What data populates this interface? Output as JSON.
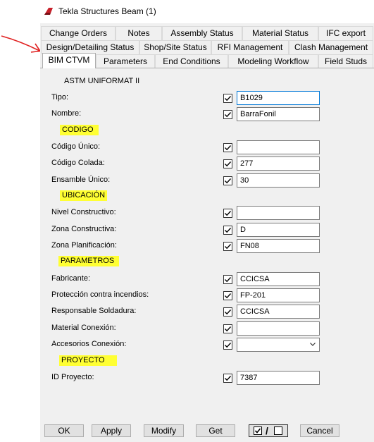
{
  "window": {
    "title": "Tekla Structures  Beam (1)"
  },
  "tabs": {
    "row1": [
      "Change Orders",
      "Notes",
      "Assembly Status",
      "Material Status",
      "IFC export"
    ],
    "row2": [
      "Design/Detailing Status",
      "Shop/Site Status",
      "RFI Management",
      "Clash Management"
    ],
    "row3": [
      "BIM CTVM",
      "Parameters",
      "End Conditions",
      "Modeling Workflow",
      "Field Studs"
    ]
  },
  "panel": {
    "caption": "ASTM UNIFORMAT II",
    "sections": [
      "CODIGO",
      "UBICACIÓN",
      "PARAMETROS",
      "PROYECTO"
    ],
    "fields": [
      {
        "label": "Tipo:",
        "value": "B1029",
        "checked": true
      },
      {
        "label": "Nombre:",
        "value": "BarraFonil",
        "checked": true
      },
      {
        "label": "Código Único:",
        "value": "",
        "checked": true
      },
      {
        "label": "Código Colada:",
        "value": "277",
        "checked": true
      },
      {
        "label": "Ensamble Único:",
        "value": "30",
        "checked": true
      },
      {
        "label": "Nivel Constructivo:",
        "value": "",
        "checked": true
      },
      {
        "label": "Zona Constructiva:",
        "value": "D",
        "checked": true
      },
      {
        "label": "Zona Planificación:",
        "value": "FN08",
        "checked": true
      },
      {
        "label": "Fabricante:",
        "value": "CCICSA",
        "checked": true
      },
      {
        "label": "Protección contra incendios:",
        "value": "FP-201",
        "checked": true
      },
      {
        "label": "Responsable Soldadura:",
        "value": "CCICSA",
        "checked": true
      },
      {
        "label": "Material Conexión:",
        "value": "",
        "checked": true
      },
      {
        "label": "Accesorios Conexión:",
        "value": "",
        "checked": true
      },
      {
        "label": "ID Proyecto:",
        "value": "7387",
        "checked": true
      }
    ]
  },
  "buttons": {
    "ok": "OK",
    "apply": "Apply",
    "modify": "Modify",
    "get": "Get",
    "cancel": "Cancel"
  },
  "colors": {
    "highlight": "#ffff33",
    "annotation_arrow": "#e02020",
    "focus_border": "#0078d7"
  }
}
